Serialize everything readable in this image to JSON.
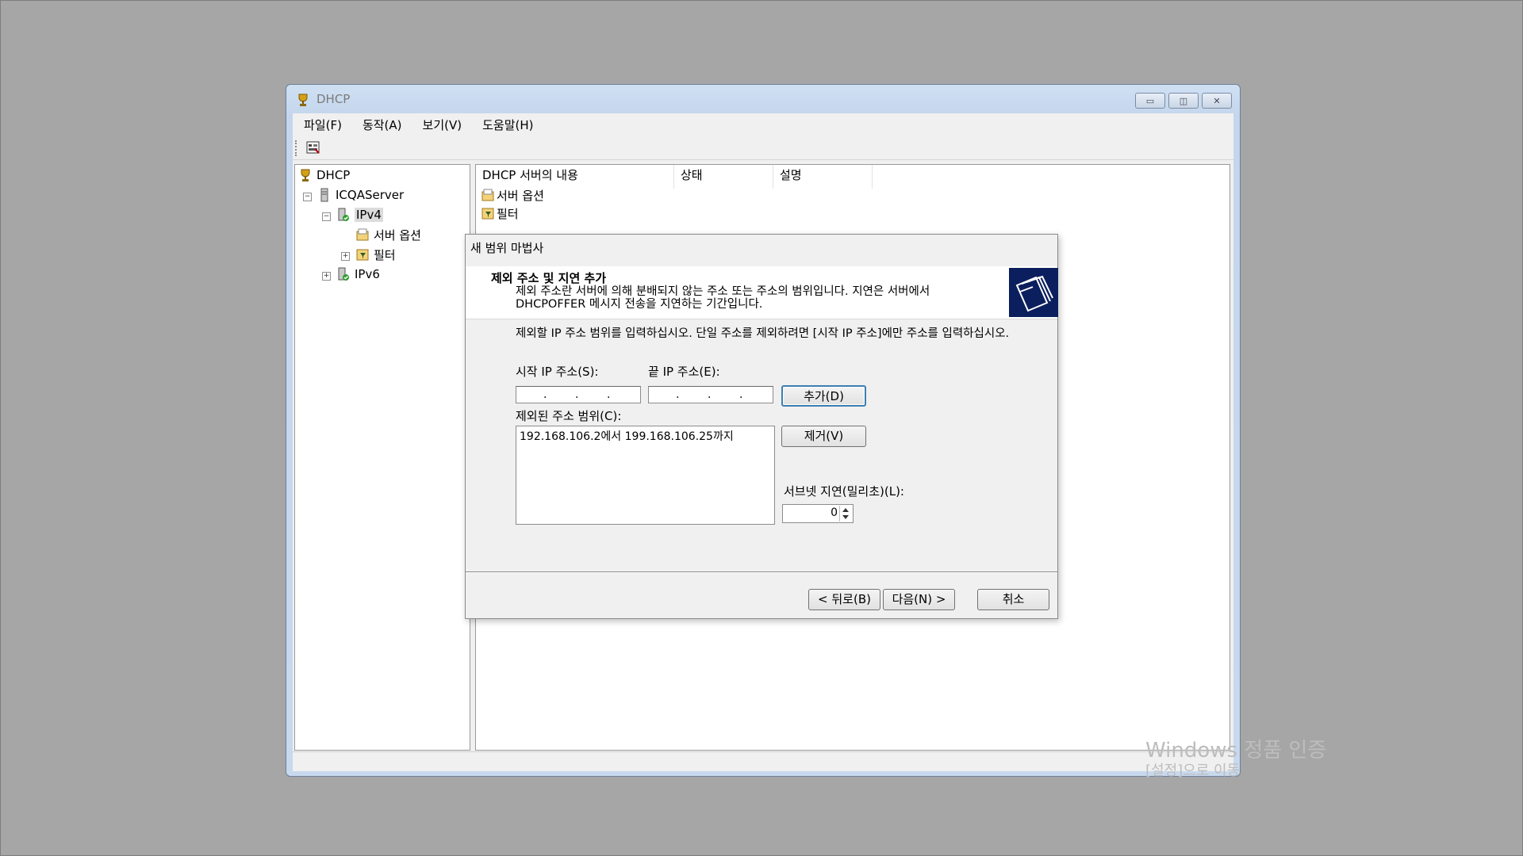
{
  "window": {
    "title": "DHCP"
  },
  "menu": [
    "파일(F)",
    "동작(A)",
    "보기(V)",
    "도움말(H)"
  ],
  "tree": {
    "root": "DHCP",
    "server": "ICQAServer",
    "ipv4": "IPv4",
    "server_options": "서버 옵션",
    "filters": "필터",
    "ipv6": "IPv6"
  },
  "list": {
    "columns": [
      "DHCP 서버의 내용",
      "상태",
      "설명"
    ],
    "rows": [
      "서버 옵션",
      "필터"
    ]
  },
  "wizard": {
    "title": "새 범위 마법사",
    "heading": "제외 주소 및 지연 추가",
    "description": "제외 주소란 서버에 의해 분배되지 않는 주소 또는 주소의 범위입니다. 지연은 서버에서 DHCPOFFER 메시지 전송을 지연하는 기간입니다.",
    "instruction": "제외할 IP 주소 범위를 입력하십시오. 단일 주소를 제외하려면 [시작 IP 주소]에만 주소를 입력하십시오.",
    "start_ip_label": "시작 IP 주소(S):",
    "end_ip_label": "끝 IP 주소(E):",
    "add_button": "추가(D)",
    "excluded_label": "제외된 주소 범위(C):",
    "excluded_ranges": [
      "192.168.106.2에서 199.168.106.25까지"
    ],
    "remove_button": "제거(V)",
    "subnet_delay_label": "서브넷 지연(밀리초)(L):",
    "subnet_delay_value": "0",
    "back_button": "< 뒤로(B)",
    "next_button": "다음(N) >",
    "cancel_button": "취소"
  },
  "watermark": {
    "line1": "Windows 정품 인증",
    "line2": "[설정]으로 이동"
  }
}
